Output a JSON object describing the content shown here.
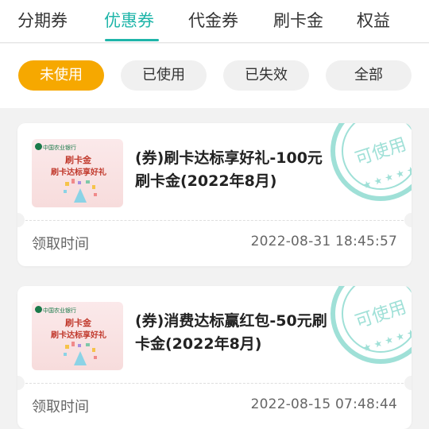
{
  "top_tabs": [
    {
      "label": "分期券",
      "active": false
    },
    {
      "label": "优惠券",
      "active": true
    },
    {
      "label": "代金券",
      "active": false
    },
    {
      "label": "刷卡金",
      "active": false
    },
    {
      "label": "权益",
      "active": false
    }
  ],
  "filters": [
    {
      "label": "未使用",
      "active": true
    },
    {
      "label": "已使用",
      "active": false
    },
    {
      "label": "已失效",
      "active": false
    },
    {
      "label": "全部",
      "active": false
    }
  ],
  "coupons": [
    {
      "thumbnail": {
        "bank": "中国农业银行",
        "line1": "刷卡金",
        "line2": "刷卡达标享好礼"
      },
      "title": "(券)刷卡达标享好礼-100元刷卡金(2022年8月)",
      "stamp": "可使用",
      "date_label": "领取时间",
      "date_value": "2022-08-31  18:45:57"
    },
    {
      "thumbnail": {
        "bank": "中国农业银行",
        "line1": "刷卡金",
        "line2": "刷卡达标享好礼"
      },
      "title": "(券)消费达标赢红包-50元刷卡金(2022年8月)",
      "stamp": "可使用",
      "date_label": "领取时间",
      "date_value": "2022-08-15  07:48:44"
    }
  ],
  "colors": {
    "accent": "#1fb5a9",
    "active_pill": "#f6a800",
    "stamp": "#9fe0d7"
  }
}
